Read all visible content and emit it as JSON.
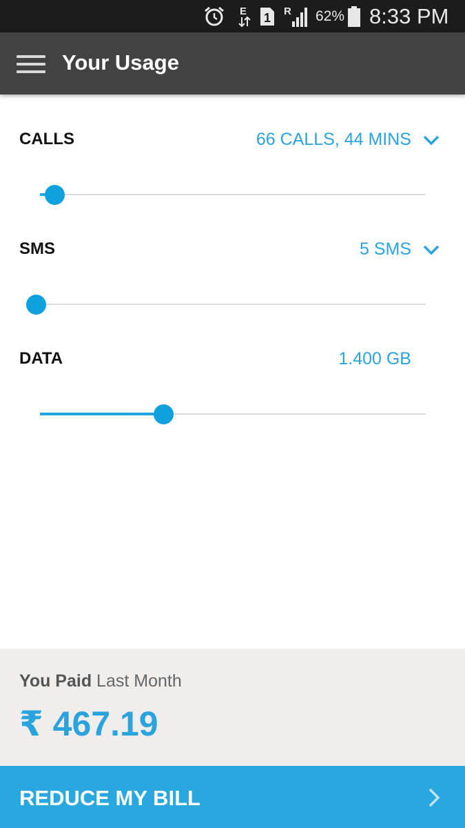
{
  "status_bar": {
    "battery_percent": "62%",
    "time": "8:33 PM",
    "network_type": "E",
    "sim_slot": "1",
    "roaming": "R",
    "icons": [
      "alarm-icon",
      "network-e-icon",
      "sim-1-icon",
      "signal-roaming-icon",
      "battery-icon"
    ]
  },
  "app_bar": {
    "title": "Your Usage",
    "menu_icon": "hamburger-menu-icon"
  },
  "usage": {
    "calls": {
      "label": "CALLS",
      "value": "66 CALLS, 44 MINS",
      "level": 0.02
    },
    "sms": {
      "label": "SMS",
      "value": "5 SMS",
      "level": 0.0
    },
    "data": {
      "label": "DATA",
      "value": "1.400 GB",
      "level": 0.32
    }
  },
  "bill": {
    "paid_bold": "You Paid",
    "paid_rest": " Last Month",
    "amount": "₹ 467.19"
  },
  "cta": {
    "label": "REDUCE MY BILL"
  },
  "colors": {
    "accent": "#2ba3dc",
    "app_bar": "#424242",
    "status_bar": "#1c1c1c",
    "cta": "#29a8e0",
    "panel": "#f0eeed"
  }
}
